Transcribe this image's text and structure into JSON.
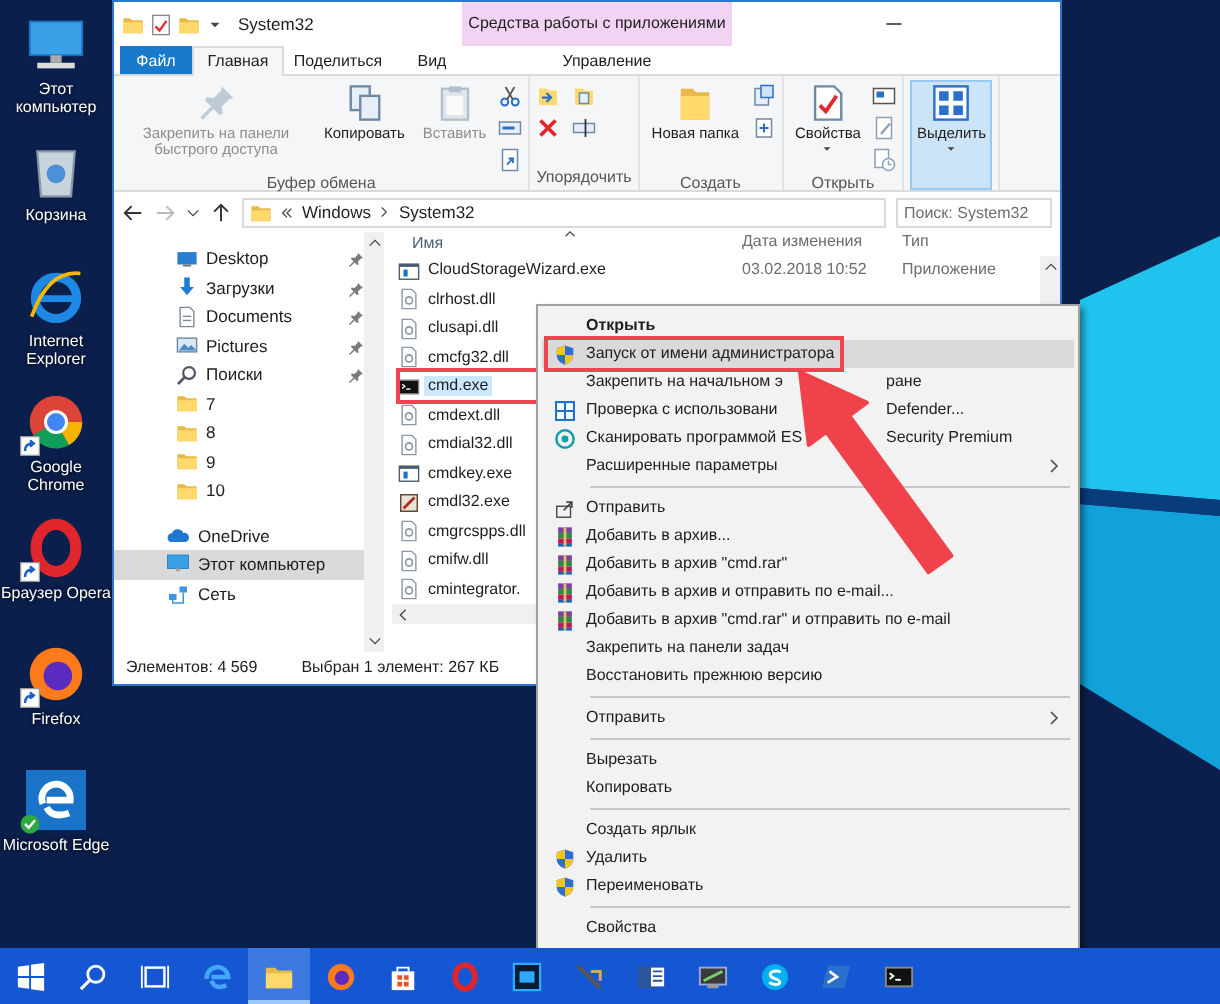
{
  "desktop_icons": [
    {
      "label": "Этот компьютер",
      "kind": "computer",
      "shortcut": false,
      "synced": false
    },
    {
      "label": "Корзина",
      "kind": "recycle",
      "shortcut": false,
      "synced": false
    },
    {
      "label": "Internet Explorer",
      "kind": "ie",
      "shortcut": false,
      "synced": false
    },
    {
      "label": "Google Chrome",
      "kind": "chrome",
      "shortcut": true,
      "synced": false
    },
    {
      "label": "Браузер Opera",
      "kind": "opera",
      "shortcut": true,
      "synced": false
    },
    {
      "label": "Firefox",
      "kind": "firefox",
      "shortcut": true,
      "synced": false
    },
    {
      "label": "Microsoft Edge",
      "kind": "edge",
      "shortcut": false,
      "synced": true
    }
  ],
  "explorer": {
    "title": "System32",
    "context_header": "Средства работы с приложениями",
    "tabs": [
      {
        "label": "Файл",
        "kind": "file",
        "selected": false
      },
      {
        "label": "Главная",
        "kind": "tab",
        "selected": true
      },
      {
        "label": "Поделиться",
        "kind": "tab",
        "selected": false
      },
      {
        "label": "Вид",
        "kind": "tab",
        "selected": false
      },
      {
        "label": "Управление",
        "kind": "context",
        "selected": false
      }
    ],
    "ribbon": [
      {
        "label": "Буфер обмена",
        "buttons": [
          {
            "label": "Закрепить на панели быстрого доступа",
            "kind": "pin",
            "disabled": true,
            "dropdown": false,
            "selected": false
          },
          {
            "label": "Копировать",
            "kind": "copy",
            "disabled": false,
            "dropdown": false,
            "selected": false
          },
          {
            "label": "Вставить",
            "kind": "paste",
            "disabled": true,
            "dropdown": false,
            "selected": false
          }
        ],
        "tools": [
          {
            "kind": "cut"
          },
          {
            "kind": "path"
          },
          {
            "kind": "shortcut"
          }
        ]
      },
      {
        "label": "Упорядочить",
        "tools": [
          {
            "kind": "moveto"
          },
          {
            "kind": "delete"
          },
          {
            "kind": "copyto"
          },
          {
            "kind": "rename"
          }
        ]
      },
      {
        "label": "Создать",
        "buttons": [
          {
            "label": "Новая папка",
            "kind": "newfolder",
            "disabled": false,
            "dropdown": false,
            "selected": false
          }
        ],
        "tools": [
          {
            "kind": "newitem"
          },
          {
            "kind": "easyaccess"
          }
        ]
      },
      {
        "label": "Открыть",
        "buttons": [
          {
            "label": "Свойства",
            "kind": "properties",
            "disabled": false,
            "dropdown": true,
            "selected": false
          }
        ],
        "tools": [
          {
            "kind": "open"
          },
          {
            "kind": "edit"
          },
          {
            "kind": "history"
          }
        ]
      },
      {
        "buttons": [
          {
            "label": "Выделить",
            "kind": "select",
            "disabled": false,
            "dropdown": true,
            "selected": true
          }
        ]
      }
    ],
    "address": {
      "path": [
        "Windows",
        "System32"
      ],
      "search_placeholder": "Поиск: System32"
    },
    "nav": {
      "quick_access_items": [
        {
          "label": "Desktop",
          "kind": "desktop",
          "pinned": true,
          "selected": false
        },
        {
          "label": "Загрузки",
          "kind": "download",
          "pinned": true,
          "selected": false
        },
        {
          "label": "Documents",
          "kind": "documents",
          "pinned": true,
          "selected": false
        },
        {
          "label": "Pictures",
          "kind": "pictures",
          "pinned": true,
          "selected": false
        },
        {
          "label": "Поиски",
          "kind": "search",
          "pinned": true,
          "selected": false
        },
        {
          "label": "7",
          "kind": "folder",
          "pinned": false,
          "selected": false
        },
        {
          "label": "8",
          "kind": "folder",
          "pinned": false,
          "selected": false
        },
        {
          "label": "9",
          "kind": "folder",
          "pinned": false,
          "selected": false
        },
        {
          "label": "10",
          "kind": "folder",
          "pinned": false,
          "selected": false
        }
      ],
      "items": [
        {
          "label": "OneDrive",
          "kind": "onedrive",
          "selected": false
        },
        {
          "label": "Этот компьютер",
          "kind": "computer",
          "selected": true
        },
        {
          "label": "Сеть",
          "kind": "network",
          "selected": false
        }
      ]
    },
    "columns": [
      "Имя",
      "Дата изменения",
      "Тип"
    ],
    "files": [
      {
        "name": "CloudStorageWizard.exe",
        "date": "03.02.2018 10:52",
        "type": "Приложение",
        "kind": "exe",
        "selected": false,
        "framed": false
      },
      {
        "name": "clrhost.dll",
        "kind": "dll",
        "selected": false,
        "framed": false
      },
      {
        "name": "clusapi.dll",
        "kind": "dll",
        "selected": false,
        "framed": false
      },
      {
        "name": "cmcfg32.dll",
        "kind": "dll",
        "selected": false,
        "framed": false
      },
      {
        "name": "cmd.exe",
        "kind": "console",
        "selected": true,
        "framed": true
      },
      {
        "name": "cmdext.dll",
        "kind": "dll",
        "selected": false,
        "framed": false
      },
      {
        "name": "cmdial32.dll",
        "kind": "dll",
        "selected": false,
        "framed": false
      },
      {
        "name": "cmdkey.exe",
        "kind": "exe",
        "selected": false,
        "framed": false
      },
      {
        "name": "cmdl32.exe",
        "kind": "app",
        "selected": false,
        "framed": false
      },
      {
        "name": "cmgrcspps.dll",
        "kind": "dll",
        "selected": false,
        "framed": false
      },
      {
        "name": "cmifw.dll",
        "kind": "dll",
        "selected": false,
        "framed": false
      },
      {
        "name": "cmintegrator.",
        "kind": "dll",
        "selected": false,
        "framed": false
      }
    ],
    "status": [
      "Элементов: 4 569",
      "Выбран 1 элемент: 267 КБ"
    ]
  },
  "context_menu": {
    "items": [
      {
        "label": "Открыть",
        "kind": "default",
        "selected": false,
        "framed": false
      },
      {
        "label": "Запуск от имени администратора",
        "kind": "shield",
        "selected": true,
        "framed": true
      },
      {
        "label": "Закрепить на начальном э",
        "label_after": "ране",
        "kind": "plain",
        "selected": false,
        "framed": false
      },
      {
        "label": "Проверка с использовани",
        "label_after": "Defender...",
        "kind": "defender",
        "selected": false,
        "framed": false
      },
      {
        "label": "Сканировать программой ES",
        "label_after": "Security Premium",
        "kind": "eset",
        "selected": false,
        "framed": false
      },
      {
        "label": "Расширенные параметры",
        "kind": "submenu",
        "selected": false,
        "framed": false
      },
      {
        "kind": "separator"
      },
      {
        "label": "Отправить",
        "kind": "share",
        "selected": false,
        "framed": false
      },
      {
        "label": "Добавить в архив...",
        "kind": "archive",
        "selected": false,
        "framed": false
      },
      {
        "label": "Добавить в архив \"cmd.rar\"",
        "kind": "archive",
        "selected": false,
        "framed": false
      },
      {
        "label": "Добавить в архив и отправить по e-mail...",
        "kind": "archive",
        "selected": false,
        "framed": false
      },
      {
        "label": "Добавить в архив \"cmd.rar\" и отправить по e-mail",
        "kind": "archive",
        "selected": false,
        "framed": false
      },
      {
        "label": "Закрепить на панели задач",
        "kind": "plain",
        "selected": false,
        "framed": false
      },
      {
        "label": "Восстановить прежнюю версию",
        "kind": "plain",
        "selected": false,
        "framed": false
      },
      {
        "kind": "separator"
      },
      {
        "label": "Отправить",
        "kind": "submenu",
        "selected": false,
        "framed": false
      },
      {
        "kind": "separator"
      },
      {
        "label": "Вырезать",
        "kind": "plain",
        "selected": false,
        "framed": false
      },
      {
        "label": "Копировать",
        "kind": "plain",
        "selected": false,
        "framed": false
      },
      {
        "kind": "separator"
      },
      {
        "label": "Создать ярлык",
        "kind": "plain",
        "selected": false,
        "framed": false
      },
      {
        "label": "Удалить",
        "kind": "shield",
        "selected": false,
        "framed": false
      },
      {
        "label": "Переименовать",
        "kind": "shield",
        "selected": false,
        "framed": false
      },
      {
        "kind": "separator"
      },
      {
        "label": "Свойства",
        "kind": "plain",
        "selected": false,
        "framed": false
      }
    ]
  },
  "taskbar": [
    {
      "kind": "start",
      "active": false
    },
    {
      "kind": "search",
      "active": false
    },
    {
      "kind": "taskview",
      "active": false
    },
    {
      "kind": "edge",
      "active": false
    },
    {
      "kind": "explorer",
      "active": true
    },
    {
      "kind": "firefox",
      "active": false
    },
    {
      "kind": "store",
      "active": false
    },
    {
      "kind": "opera",
      "active": false
    },
    {
      "kind": "photoeditor",
      "active": false
    },
    {
      "kind": "tool",
      "active": false
    },
    {
      "kind": "word",
      "active": false
    },
    {
      "kind": "screen",
      "active": false
    },
    {
      "kind": "skype",
      "active": false
    },
    {
      "kind": "powershell",
      "active": false
    },
    {
      "kind": "console",
      "active": false
    }
  ]
}
